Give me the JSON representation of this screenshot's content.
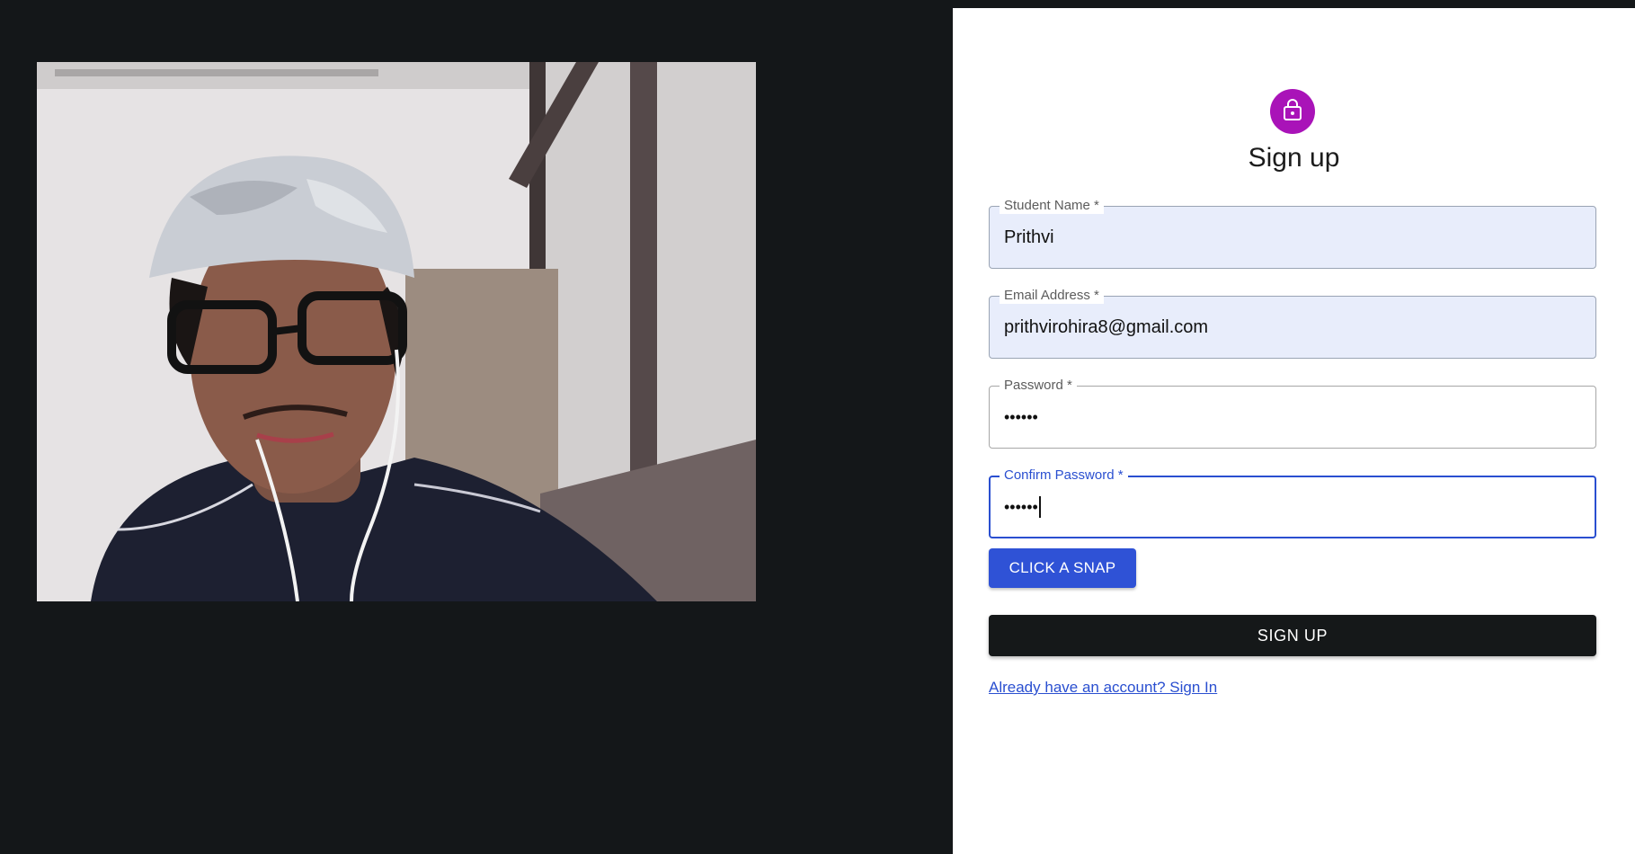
{
  "webcam": {
    "label": "webcam-feed"
  },
  "signup": {
    "title": "Sign up",
    "fields": [
      {
        "label": "Student Name *",
        "value": "Prithvi"
      },
      {
        "label": "Email Address *",
        "value": "prithvirohira8@gmail.com"
      },
      {
        "label": "Password *",
        "value": "••••••"
      },
      {
        "label": "Confirm Password *",
        "value": "••••••"
      }
    ],
    "snap_button": "CLICK A SNAP",
    "submit_button": "SIGN UP",
    "signin_link": "Already have an account? Sign In"
  },
  "colors": {
    "background": "#141719",
    "avatar": "#a913b8",
    "accent": "#2f52d6",
    "submit": "#151819",
    "autofill": "#e8edfb"
  },
  "icons": {
    "avatar_icon": "lock-icon"
  }
}
